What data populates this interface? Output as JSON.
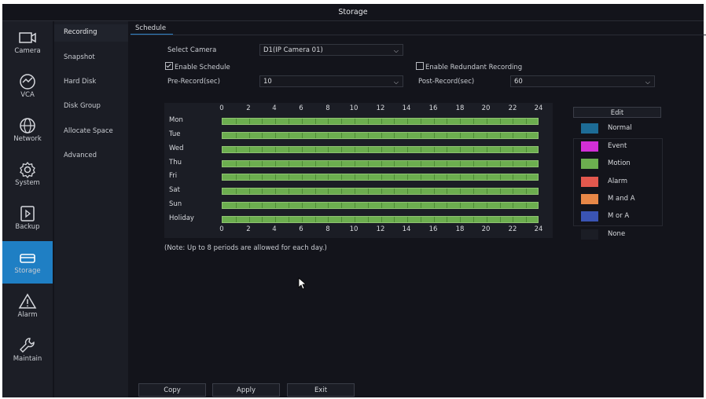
{
  "window": {
    "title": "Storage"
  },
  "nav": {
    "items": [
      {
        "label": "Camera",
        "icon": "camera-icon"
      },
      {
        "label": "VCA",
        "icon": "vca-icon"
      },
      {
        "label": "Network",
        "icon": "globe-icon"
      },
      {
        "label": "System",
        "icon": "gear-icon"
      },
      {
        "label": "Backup",
        "icon": "backup-icon"
      },
      {
        "label": "Storage",
        "icon": "storage-icon",
        "active": true
      },
      {
        "label": "Alarm",
        "icon": "alarm-icon"
      },
      {
        "label": "Maintain",
        "icon": "wrench-icon"
      }
    ]
  },
  "subnav": {
    "items": [
      "Recording",
      "Snapshot",
      "Hard Disk",
      "Disk Group",
      "Allocate Space",
      "Advanced"
    ],
    "active": "Recording"
  },
  "tab": {
    "label": "Schedule"
  },
  "form": {
    "select_camera_label": "Select Camera",
    "select_camera_value": "D1(IP Camera 01)",
    "enable_schedule_label": "Enable Schedule",
    "enable_schedule_checked": true,
    "enable_redundant_label": "Enable Redundant Recording",
    "enable_redundant_checked": false,
    "pre_record_label": "Pre-Record(sec)",
    "pre_record_value": "10",
    "post_record_label": "Post-Record(sec)",
    "post_record_value": "60"
  },
  "schedule": {
    "hours": [
      "0",
      "2",
      "4",
      "6",
      "8",
      "10",
      "12",
      "14",
      "16",
      "18",
      "20",
      "22",
      "24"
    ],
    "days": [
      "Mon",
      "Tue",
      "Wed",
      "Thu",
      "Fri",
      "Sat",
      "Sun",
      "Holiday"
    ],
    "bar_color": "#6cae4f",
    "note": "(Note: Up to 8 periods are allowed for each day.)"
  },
  "legend": {
    "edit_label": "Edit",
    "items": [
      {
        "label": "Normal",
        "color": "#1d6c96"
      },
      {
        "label": "Event",
        "color": "#d12fd6"
      },
      {
        "label": "Motion",
        "color": "#6cae4f"
      },
      {
        "label": "Alarm",
        "color": "#e2584e"
      },
      {
        "label": "M and A",
        "color": "#e78747"
      },
      {
        "label": "M or A",
        "color": "#3a54b4"
      },
      {
        "label": "None",
        "color": "#1b1d25"
      }
    ]
  },
  "buttons": {
    "copy": "Copy",
    "apply": "Apply",
    "exit": "Exit"
  }
}
